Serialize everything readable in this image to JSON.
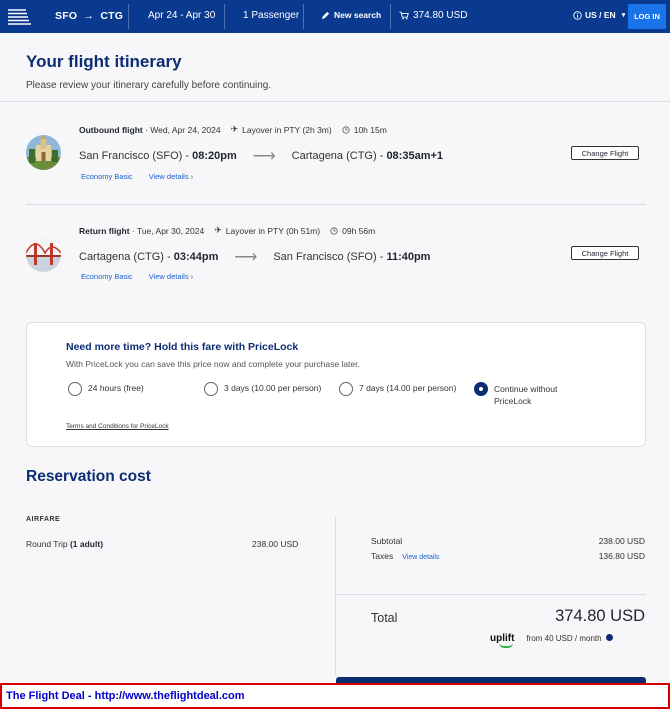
{
  "header": {
    "route_from": "SFO",
    "route_to": "CTG",
    "dates": "Apr 24 - Apr 30",
    "passengers": "1 Passenger",
    "new_search": "New search",
    "cart_total": "374.80 USD",
    "locale": "US / EN",
    "login": "LOG IN"
  },
  "itinerary": {
    "title": "Your flight itinerary",
    "subtitle": "Please review your itinerary carefully before continuing.",
    "flights": [
      {
        "label": "Outbound flight",
        "date": "· Wed, Apr 24, 2024",
        "layover": "Layover in PTY (2h 3m)",
        "duration": "10h 15m",
        "from_city": "San Francisco (SFO) -",
        "from_time": "08:20pm",
        "to_city": "Cartagena (CTG) -",
        "to_time": "08:35am+1",
        "fare": "Economy Basic",
        "details": "View details",
        "change": "Change Flight"
      },
      {
        "label": "Return flight",
        "date": "· Tue, Apr 30, 2024",
        "layover": "Layover in PTY (0h 51m)",
        "duration": "09h 56m",
        "from_city": "Cartagena (CTG) -",
        "from_time": "03:44pm",
        "to_city": "San Francisco (SFO) -",
        "to_time": "11:40pm",
        "fare": "Economy Basic",
        "details": "View details",
        "change": "Change Flight"
      }
    ]
  },
  "pricelock": {
    "title": "Need more time? Hold this fare with PriceLock",
    "subtitle": "With PriceLock you can save this price now and complete your purchase later.",
    "options": [
      {
        "label": "24 hours (free)",
        "selected": false
      },
      {
        "label": "3 days (10.00 per person)",
        "selected": false
      },
      {
        "label": "7 days (14.00 per person)",
        "selected": false
      },
      {
        "label": "Continue without PriceLock",
        "selected": true
      }
    ],
    "terms": "Terms and Conditions for PriceLock"
  },
  "cost": {
    "title": "Reservation cost",
    "airfare_label": "AIRFARE",
    "round_trip_label": "Round Trip",
    "round_trip_qty": "(1 adult)",
    "round_trip_value": "238.00 USD",
    "subtotal_label": "Subtotal",
    "subtotal_value": "238.00 USD",
    "taxes_label": "Taxes",
    "taxes_details": "View details",
    "taxes_value": "136.80 USD",
    "total_label": "Total",
    "total_value": "374.80 USD",
    "uplift_brand": "uplift",
    "uplift_text": "from 40 USD  / month"
  },
  "banner": {
    "text": "The Flight Deal - http://www.theflightdeal.com"
  },
  "colors": {
    "header_bg": "#0a3a8f",
    "brand_navy": "#0d2d73",
    "link_blue": "#1a5fd1",
    "login_blue": "#1a73e8",
    "banner_border": "#d40000"
  }
}
